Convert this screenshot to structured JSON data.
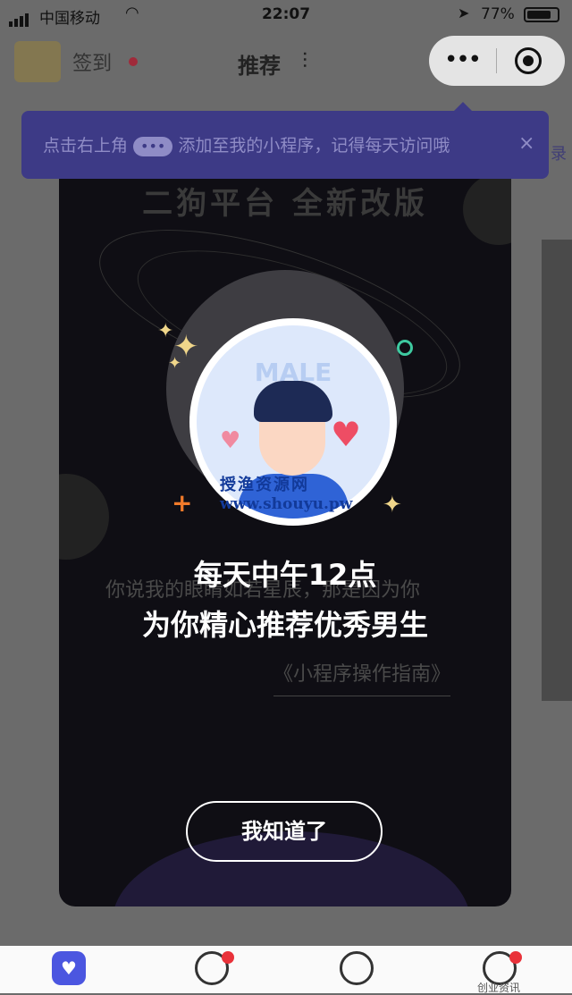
{
  "status_bar": {
    "carrier": "中国移动",
    "time": "22:07",
    "battery": "77%",
    "icons": [
      "signal-icon",
      "wifi-icon",
      "location-arrow-icon",
      "battery-icon"
    ]
  },
  "header": {
    "signin_label": "签到",
    "title": "推荐",
    "filter_icon": "sliders-icon",
    "capsule_more": "•••",
    "capsule_close_icon": "target-icon"
  },
  "tip": {
    "text_before": "点击右上角",
    "pill": "•••",
    "text_after": "添加至我的小程序，记得每天访问哦",
    "close": "×"
  },
  "background": {
    "side_text": "录"
  },
  "modal": {
    "headline": "二狗平台 全新改版",
    "avatar_label": "MALE",
    "watermark_cn": "授渔资源网",
    "watermark_url": "www.shouyu.pw",
    "bg_text": "你说我的眼睛如若星辰，那是因为你",
    "guide": "《小程序操作指南》",
    "line1": "每天中午12点",
    "line2": "为你精心推荐优秀男生",
    "ok_button": "我知道了"
  },
  "tabbar": {
    "tabs": [
      {
        "icon": "heart-shield-icon",
        "badge": false
      },
      {
        "icon": "planet-icon",
        "badge": true
      },
      {
        "icon": "ghost-face-icon",
        "badge": false
      },
      {
        "icon": "smile-bubble-icon",
        "badge": true
      }
    ],
    "watermark": "创业资讯"
  },
  "colors": {
    "accent": "#4b56e0",
    "tip_bg": "#3d3a86",
    "badge": "#e9323a"
  }
}
